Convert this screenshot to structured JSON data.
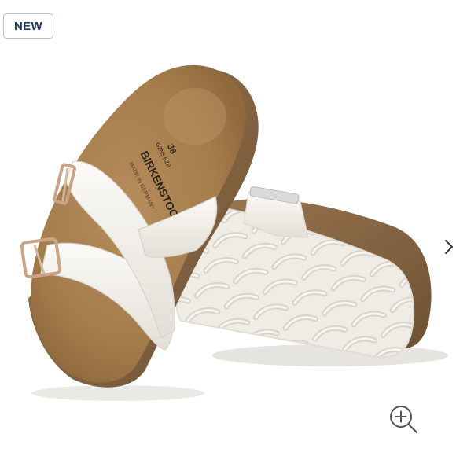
{
  "badge": {
    "label": "NEW"
  },
  "product_image": {
    "brand_print": "BIRKENSTOCK",
    "size_print": "38",
    "size_codes": "GZN5 EZB"
  },
  "controls": {
    "next_icon": "chevron-right-icon",
    "zoom_icon": "zoom-in-icon"
  },
  "colors": {
    "cork": "#8a6a44",
    "footbed": "#a8804f",
    "strap": "#f4f2ee",
    "sole": "#eeeae2",
    "buckle": "#c9a488",
    "badge_text": "#1f3a63"
  }
}
